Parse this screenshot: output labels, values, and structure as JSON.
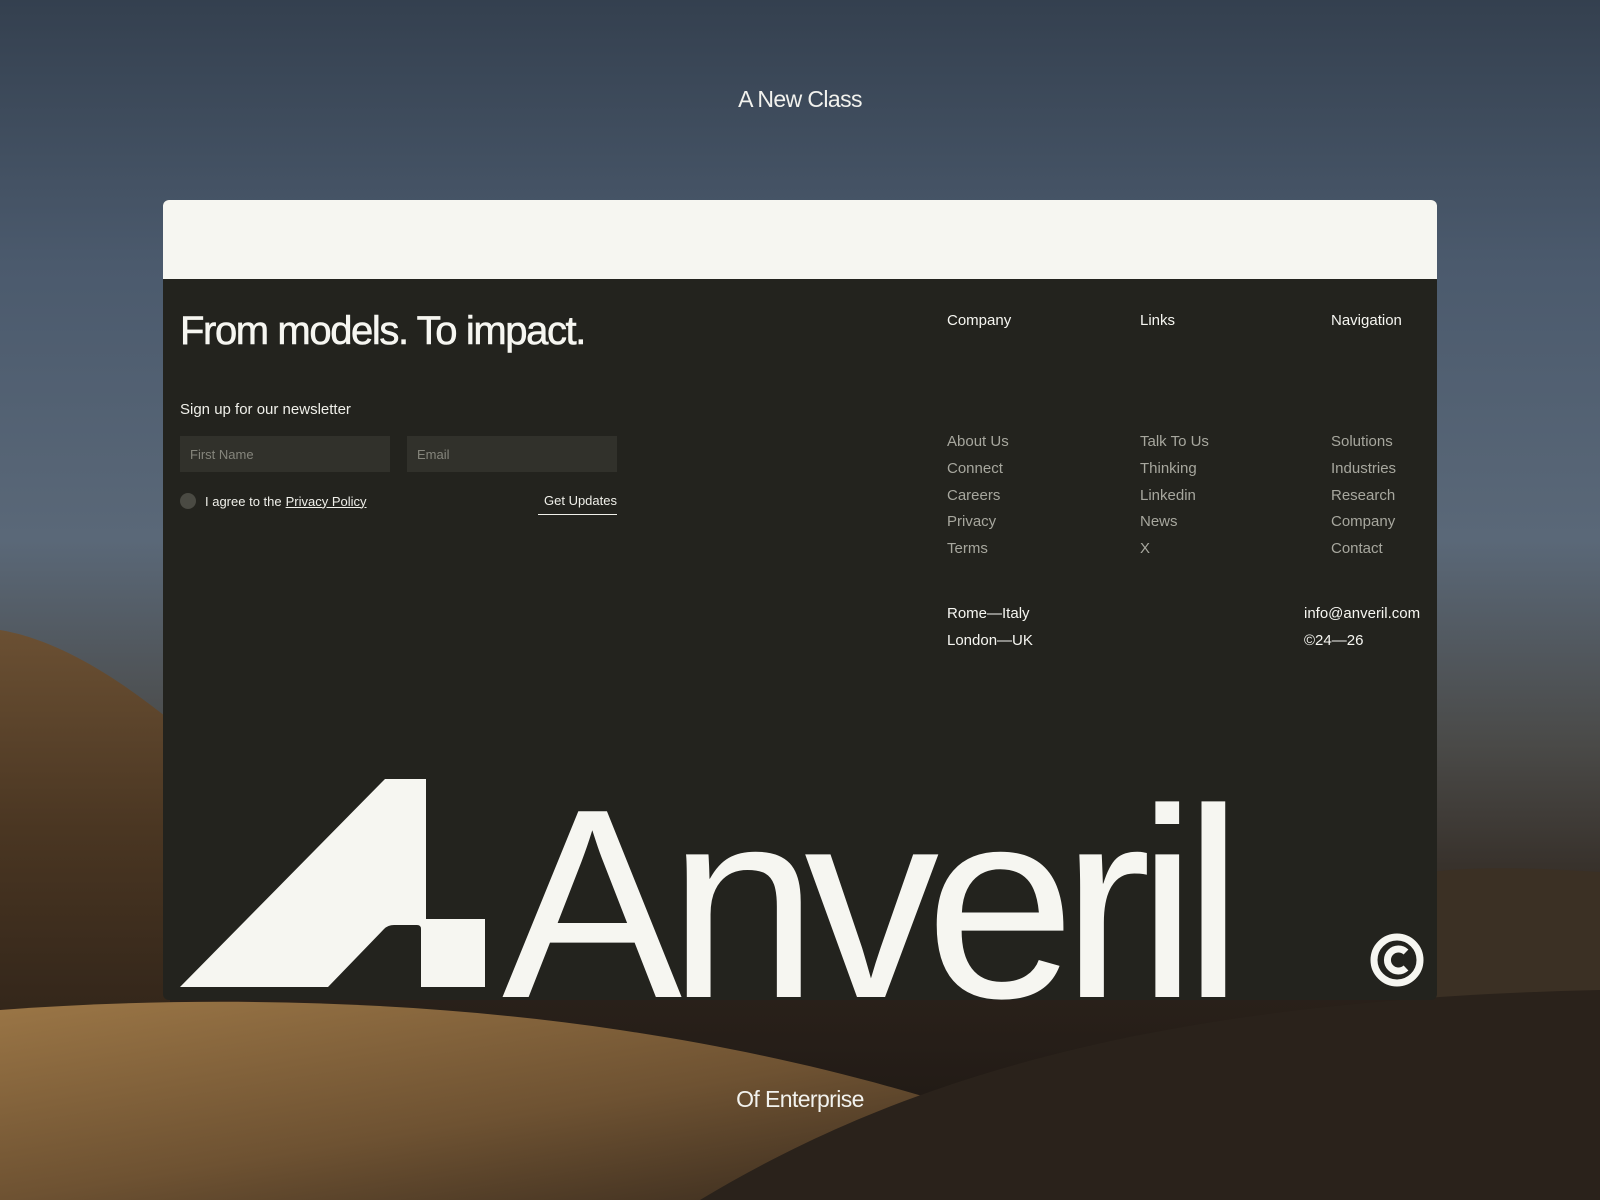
{
  "background": {
    "top_caption": "A New Class",
    "bottom_caption": "Of Enterprise"
  },
  "footer": {
    "headline": "From models. To impact.",
    "newsletter": {
      "label": "Sign up for our newsletter",
      "first_name_placeholder": "First Name",
      "email_placeholder": "Email",
      "agree_prefix": "I agree to the",
      "privacy_link": "Privacy Policy",
      "submit_label": "Get Updates"
    },
    "columns": {
      "company": {
        "heading": "Company",
        "items": [
          "About Us",
          "Connect",
          "Careers",
          "Privacy",
          "Terms"
        ]
      },
      "links": {
        "heading": "Links",
        "items": [
          "Talk To Us",
          "Thinking",
          "Linkedin",
          "News",
          "X"
        ]
      },
      "navigation": {
        "heading": "Navigation",
        "items": [
          "Solutions",
          "Industries",
          "Research",
          "Company",
          "Contact"
        ]
      }
    },
    "locations": [
      "Rome—Italy",
      "London—UK"
    ],
    "contact": {
      "email": "info@anveril.com",
      "copyright": "©24—26"
    },
    "wordmark": "Anveril"
  },
  "colors": {
    "card_background": "#23231e",
    "card_top_band": "#f6f6f1",
    "text_primary": "#f6f6f1",
    "text_muted": "#a7a79e",
    "input_background": "#31312b"
  },
  "icons": {
    "logo_mark": "anveril-a-mark-icon",
    "copyright": "copyright-icon",
    "checkbox": "radio-circle-icon"
  }
}
